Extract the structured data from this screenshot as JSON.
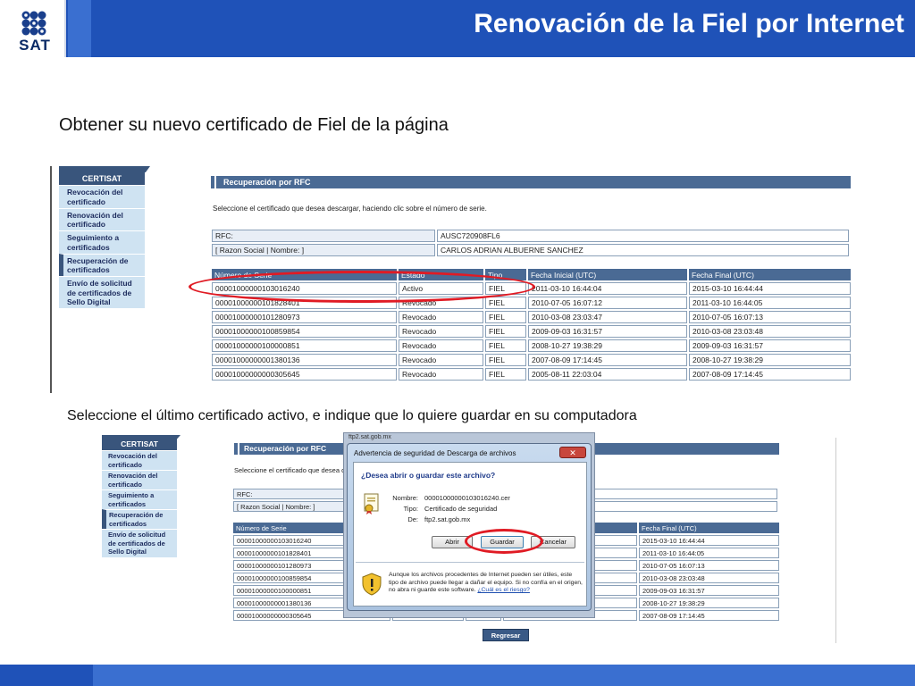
{
  "header": {
    "title": "Renovación de la Fiel por Internet",
    "logo_text": "SAT"
  },
  "instructions": {
    "step1": "Obtener su nuevo certificado de Fiel de la página",
    "step2": "Seleccione el último certificado activo, e indique que lo quiere guardar en su computadora"
  },
  "sidebar": {
    "title": "CERTISAT",
    "items": [
      {
        "label": "Revocación del certificado"
      },
      {
        "label": "Renovación del certificado"
      },
      {
        "label": "Seguimiento a certificados"
      },
      {
        "label": "Recuperación de certificados"
      },
      {
        "label": "Envío de solicitud de certificados de Sello Digital"
      }
    ]
  },
  "rfc_page": {
    "bar_title": "Recuperación por RFC",
    "instruction": "Seleccione el certificado que desea descargar, haciendo clic sobre el número de serie.",
    "instruction_truncated": "Seleccione el certificado que desea d",
    "rfc_label": "RFC:",
    "rfc_value": "AUSC720908FL6",
    "razon_label": "[ Razon Social | Nombre: ]",
    "razon_value": "CARLOS ADRIAN ALBUERNE SANCHEZ",
    "columns": [
      "Número de Serie",
      "Estado",
      "Tipo",
      "Fecha Inicial (UTC)",
      "Fecha Final (UTC)"
    ],
    "rows": [
      [
        "00001000000103016240",
        "Activo",
        "FIEL",
        "2011-03-10 16:44:04",
        "2015-03-10 16:44:44"
      ],
      [
        "00001000000101828401",
        "Revocado",
        "FIEL",
        "2010-07-05 16:07:12",
        "2011-03-10 16:44:05"
      ],
      [
        "00001000000101280973",
        "Revocado",
        "FIEL",
        "2010-03-08 23:03:47",
        "2010-07-05 16:07:13"
      ],
      [
        "00001000000100859854",
        "Revocado",
        "FIEL",
        "2009-09-03 16:31:57",
        "2010-03-08 23:03:48"
      ],
      [
        "00001000000100000851",
        "Revocado",
        "FIEL",
        "2008-10-27 19:38:29",
        "2009-09-03 16:31:57"
      ],
      [
        "00001000000001380136",
        "Revocado",
        "FIEL",
        "2007-08-09 17:14:45",
        "2008-10-27 19:38:29"
      ],
      [
        "00001000000000305645",
        "Revocado",
        "FIEL",
        "2005-08-11 22:03:04",
        "2007-08-09 17:14:45"
      ]
    ],
    "back_button": "Regresar"
  },
  "dialog": {
    "behind_title": "ftp2.sat.gob.mx",
    "title": "Advertencia de seguridad de Descarga de archivos",
    "close_glyph": "✕",
    "question": "¿Desea abrir o guardar este archivo?",
    "name_label": "Nombre:",
    "name_value": "00001000000103016240.cer",
    "type_label": "Tipo:",
    "type_value": "Certificado de seguridad",
    "from_label": "De:",
    "from_value": "ftp2.sat.gob.mx",
    "open_button": "Abrir",
    "save_button": "Guardar",
    "cancel_button": "Cancelar",
    "warning": "Aunque los archivos procedentes de Internet pueden ser útiles, este tipo de archivo puede llegar a dañar el equipo. Si no confía en el origen, no abra ni guarde este software.",
    "warning_link": "¿Cuál es el riesgo?"
  },
  "colors": {
    "header_blue": "#1f52b8",
    "accent_blue": "#3a6fd0",
    "table_header": "#4a6a94",
    "highlight_red": "#e01b24"
  }
}
